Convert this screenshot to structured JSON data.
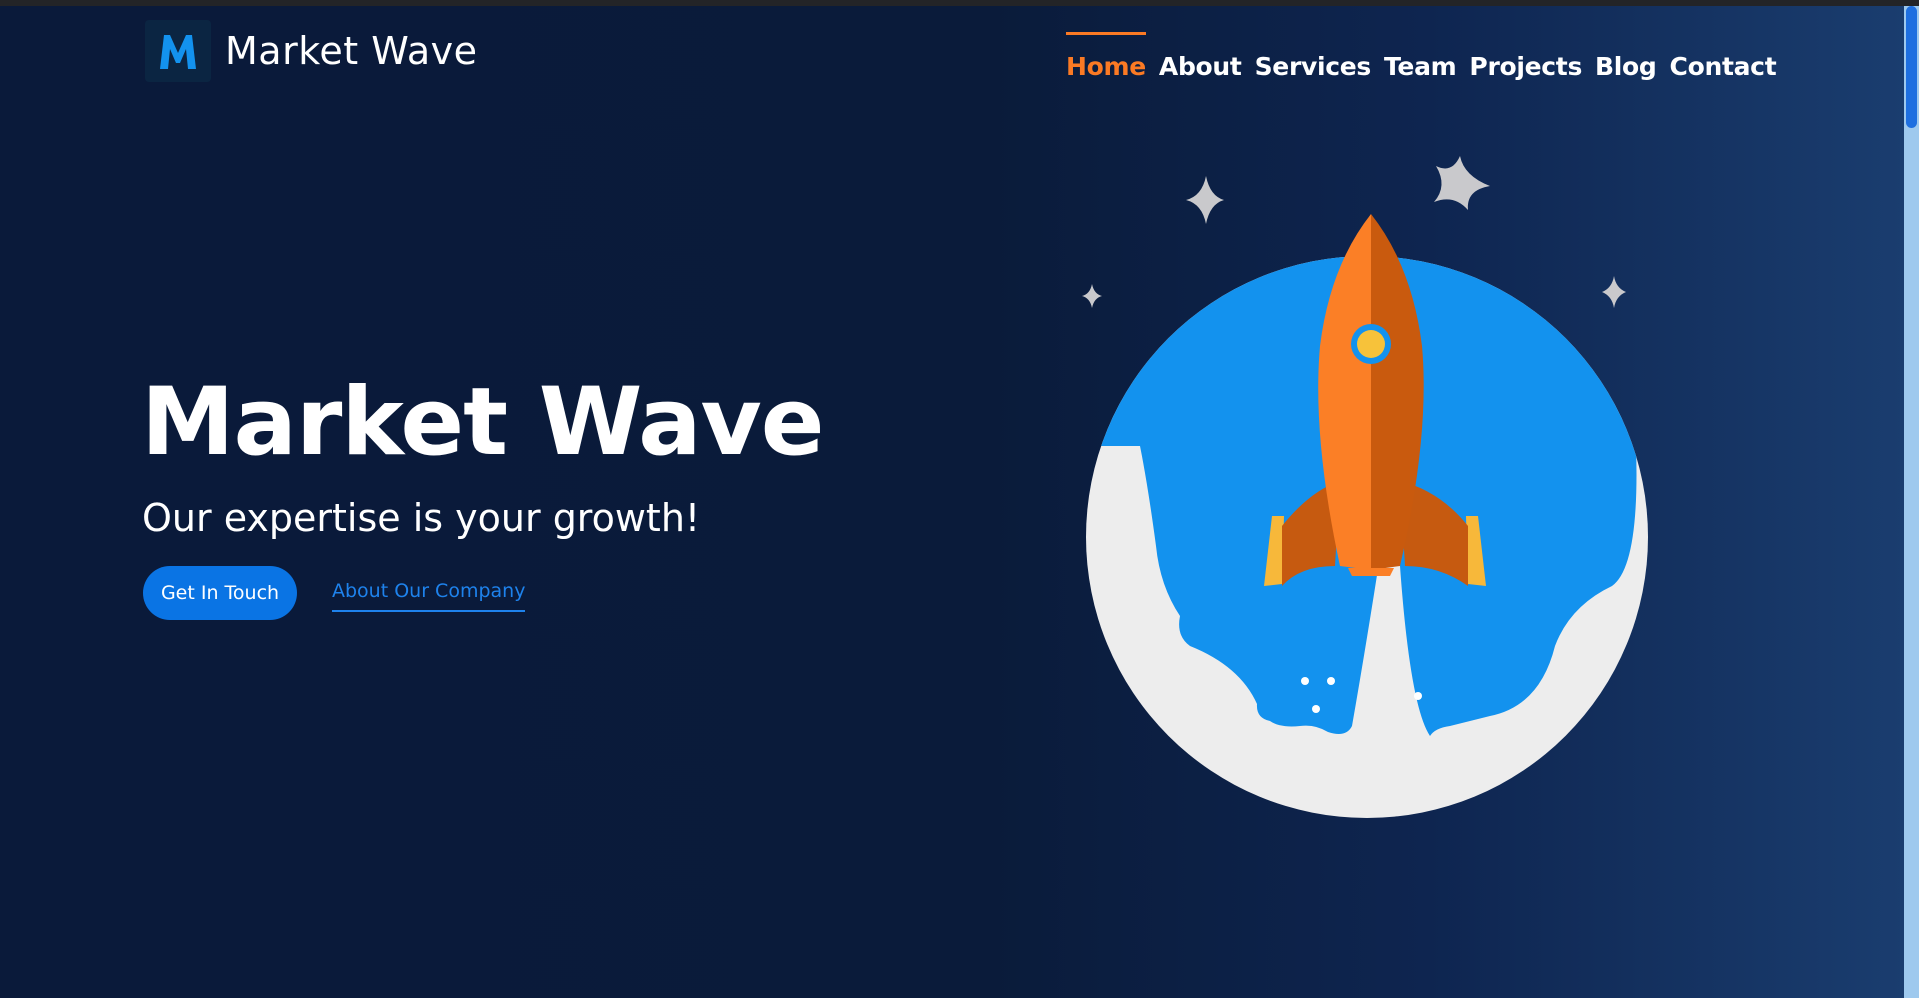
{
  "brand": {
    "name": "Market Wave",
    "logo_letter": "M"
  },
  "nav": {
    "items": [
      {
        "label": "Home",
        "active": true
      },
      {
        "label": "About",
        "active": false
      },
      {
        "label": "Services",
        "active": false
      },
      {
        "label": "Team",
        "active": false
      },
      {
        "label": "Projects",
        "active": false
      },
      {
        "label": "Blog",
        "active": false
      },
      {
        "label": "Contact",
        "active": false
      }
    ]
  },
  "hero": {
    "title": "Market Wave",
    "subtitle": "Our expertise is your growth!",
    "primary_button": "Get In Touch",
    "secondary_link": "About Our Company"
  },
  "colors": {
    "background": "#0a1a3a",
    "accent_orange": "#fb7a24",
    "accent_blue": "#0a74e4",
    "illustration_blue": "#1392ee"
  },
  "icons": {
    "logo": "m-logo-icon",
    "illustration": "rocket-launch-illustration"
  }
}
